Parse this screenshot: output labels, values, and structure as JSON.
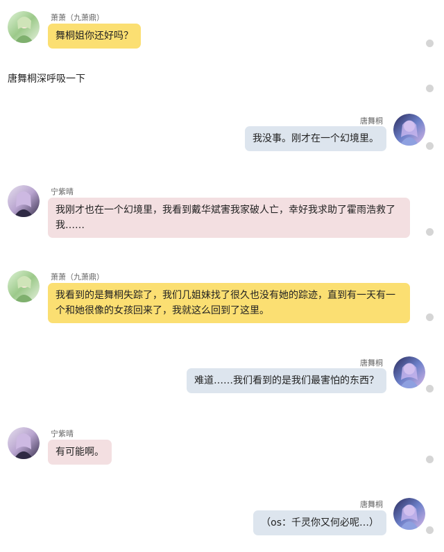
{
  "characters": {
    "xiao": {
      "name": "萧萧（九萧鼎）",
      "avatar_icon": "green-fairy-avatar-icon"
    },
    "tang": {
      "name": "唐舞桐",
      "avatar_icon": "blue-fairy-avatar-icon"
    },
    "ning": {
      "name": "宁紫晴",
      "avatar_icon": "purple-girl-avatar-icon"
    }
  },
  "messages": [
    {
      "speaker": "萧萧（九萧鼎）",
      "side": "left",
      "text": "舞桐姐你还好吗？"
    },
    {
      "type": "narration",
      "text": "唐舞桐深呼吸一下"
    },
    {
      "speaker": "唐舞桐",
      "side": "right",
      "text": "我没事。刚才在一个幻境里。"
    },
    {
      "speaker": "宁紫晴",
      "side": "left",
      "text": "我刚才也在一个幻境里，我看到戴华斌害我家破人亡，幸好我求助了霍雨浩救了我……"
    },
    {
      "speaker": "萧萧（九萧鼎）",
      "side": "left",
      "text": "我看到的是舞桐失踪了，我们几姐妹找了很久也没有她的踪迹，直到有一天有一个和她很像的女孩回来了，我就这么回到了这里。"
    },
    {
      "speaker": "唐舞桐",
      "side": "right",
      "text": "难道……我们看到的是我们最害怕的东西？"
    },
    {
      "speaker": "宁紫晴",
      "side": "left",
      "text": "有可能啊。"
    },
    {
      "speaker": "唐舞桐",
      "side": "right",
      "text": "（os：千灵你又何必呢…）"
    }
  ],
  "colors": {
    "xiao_bubble": "#fbdf72",
    "ning_bubble": "#f3dfe1",
    "tang_bubble": "#dde5ee",
    "indicator_dot": "#d5d5d5"
  }
}
